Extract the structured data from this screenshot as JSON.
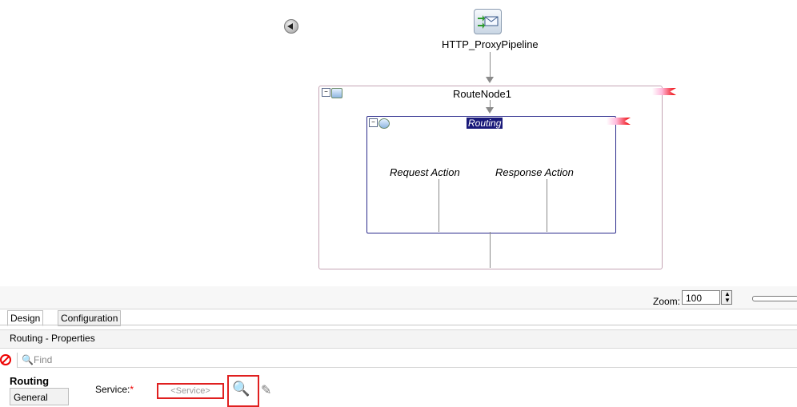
{
  "canvas": {
    "pipeline": {
      "label": "HTTP_ProxyPipeline",
      "icon": "envelope-pipeline-icon"
    },
    "route_node": {
      "label": "RouteNode1",
      "collapse_symbol": "−"
    },
    "routing": {
      "label": "Routing",
      "collapse_symbol": "−",
      "request_label": "Request Action",
      "response_label": "Response Action"
    }
  },
  "zoom": {
    "label": "Zoom:",
    "value": "100",
    "spinner": "▲▼"
  },
  "tabs": [
    {
      "label": "Design",
      "active": true
    },
    {
      "label": "Configuration",
      "active": false
    }
  ],
  "properties": {
    "title": "Routing - Properties",
    "find_placeholder": "Find",
    "find_glass": "🔍",
    "section": "Routing",
    "general_tab": "General",
    "service_label": "Service:",
    "required_mark": "*",
    "service_placeholder": "<Service>",
    "search_glyph": "🔍",
    "pencil_glyph": "✎"
  },
  "colors": {
    "highlight": "#e02020",
    "routing_title_bg": "#1a1a7a",
    "routing_border": "#2c2c8c"
  }
}
